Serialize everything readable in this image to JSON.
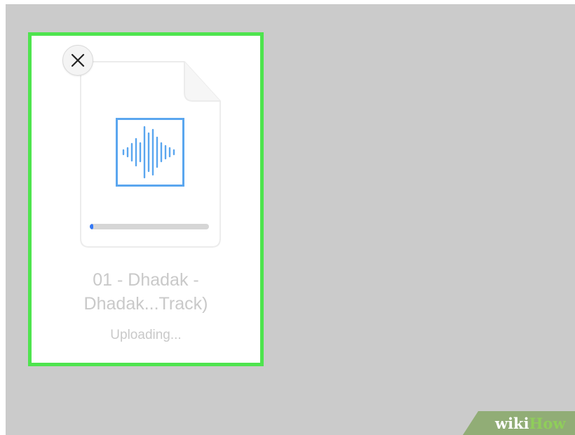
{
  "file_card": {
    "file_name_line1": "01 - Dhadak -",
    "file_name_line2": "Dhadak...Track)",
    "status": "Uploading...",
    "upload_progress": 0.03,
    "close_icon": "close-icon",
    "file_icon": "audio-waveform-icon"
  },
  "watermark": {
    "part1": "wiki",
    "part2": "How"
  },
  "colors": {
    "background": "#cbcbcb",
    "highlight_border": "#4ee44e",
    "accent": "#3478f6",
    "icon_blue": "#5aa6ef"
  }
}
